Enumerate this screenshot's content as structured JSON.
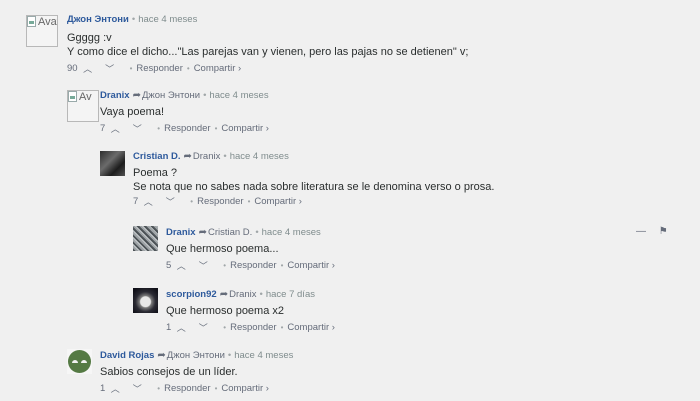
{
  "colors": {
    "author": "#2e5a9c",
    "muted": "#656c7a",
    "background": "#f0f0f0"
  },
  "labels": {
    "reply": "Responder",
    "share": "Compartir ›",
    "upvote_icon": "chevron-up-icon",
    "downvote_icon": "chevron-down-icon",
    "reply_icon": "reply-arrow-icon"
  },
  "comments": [
    {
      "avatar_alt": "Avat",
      "author": "Джон Энтони",
      "time": "hace 4 meses",
      "lines": [
        "Ggggg :v",
        "Y como dice el dicho...\"Las parejas van y vienen, pero las pajas no se detienen\" v;"
      ],
      "votes": "90"
    },
    {
      "avatar_alt": "Av",
      "author": "Dranix",
      "reply_to": "Джон Энтони",
      "time": "hace 4 meses",
      "lines": [
        "Vaya poema!"
      ],
      "votes": "7"
    },
    {
      "author": "Cristian D.",
      "reply_to": "Dranix",
      "time": "hace 4 meses",
      "lines": [
        "Poema ?",
        "Se nota que no sabes nada sobre literatura se le denomina verso o prosa."
      ],
      "votes": "7"
    },
    {
      "author": "Dranix",
      "reply_to": "Cristian D.",
      "time": "hace 4 meses",
      "lines": [
        "Que hermoso poema..."
      ],
      "votes": "5",
      "side_actions": {
        "collapse": "—",
        "flag_icon": "flag-icon"
      }
    },
    {
      "author": "scorpion92",
      "reply_to": "Dranix",
      "time": "hace 7 días",
      "lines": [
        "Que hermoso poema x2"
      ],
      "votes": "1"
    },
    {
      "author": "David Rojas",
      "reply_to": "Джон Энтони",
      "time": "hace 4 meses",
      "lines": [
        "Sabios consejos de un líder."
      ],
      "votes": "1"
    }
  ]
}
